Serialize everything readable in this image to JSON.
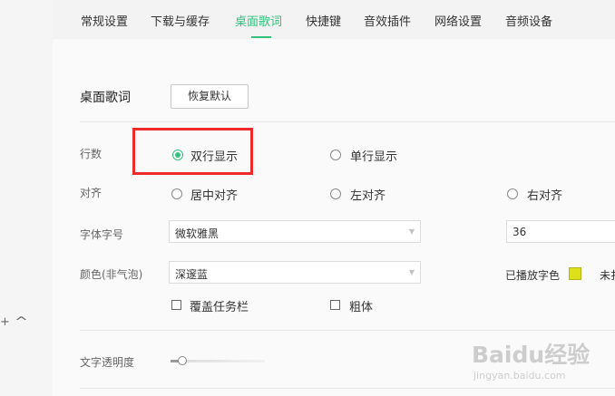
{
  "tabs": [
    {
      "label": "常规设置",
      "active": false
    },
    {
      "label": "下载与缓存",
      "active": false
    },
    {
      "label": "桌面歌词",
      "active": true
    },
    {
      "label": "快捷键",
      "active": false
    },
    {
      "label": "音效插件",
      "active": false
    },
    {
      "label": "网络设置",
      "active": false
    },
    {
      "label": "音频设备",
      "active": false
    }
  ],
  "left_controls": {
    "plus_icon": "+",
    "chevron_icon": "^"
  },
  "section": {
    "title": "桌面歌词",
    "reset_button": "恢复默认"
  },
  "rows": {
    "lines": {
      "label": "行数",
      "options": [
        "双行显示",
        "单行显示"
      ],
      "selected": "双行显示"
    },
    "align": {
      "label": "对齐",
      "options": [
        "居中对齐",
        "左对齐",
        "右对齐"
      ],
      "selected": null
    },
    "font": {
      "label": "字体字号",
      "family": "微软雅黑",
      "size": "36"
    },
    "color": {
      "label": "颜色(非气泡)",
      "scheme": "深邃蓝",
      "played_label": "已播放字色",
      "played_color": "#dfe01c",
      "unplayed_label_partial": "未扌"
    },
    "checkboxes": [
      {
        "label": "覆盖任务栏",
        "checked": false
      },
      {
        "label": "粗体",
        "checked": false
      }
    ],
    "opacity": {
      "label": "文字透明度",
      "value_fraction": 0.12
    }
  },
  "colors": {
    "accent": "#31c27c",
    "highlight_box": "#ee2a2a"
  },
  "watermark": {
    "brand": "Baidu经验",
    "url": "jingyan.baidu.com"
  }
}
